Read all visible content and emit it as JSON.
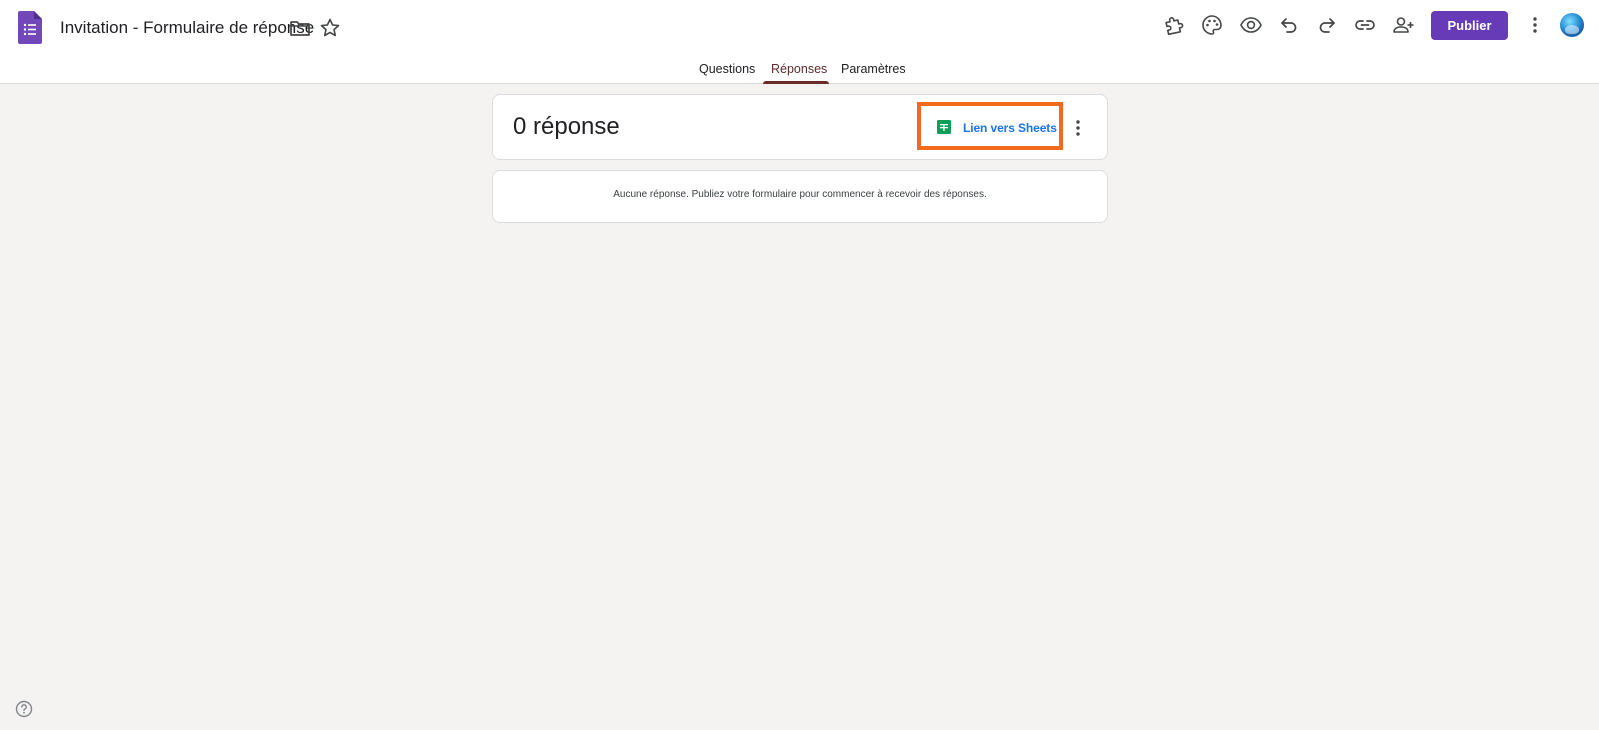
{
  "header": {
    "title": "Invitation - Formulaire de réponse",
    "publish_label": "Publier",
    "icons": [
      "forms-logo-icon",
      "folder-icon",
      "star-icon",
      "addon-puzzle-icon",
      "palette-icon",
      "preview-eye-icon",
      "undo-icon",
      "redo-icon",
      "link-icon",
      "add-collaborator-icon",
      "more-vert-icon",
      "avatar"
    ]
  },
  "tabs": [
    {
      "label": "Questions",
      "active": false
    },
    {
      "label": "Réponses",
      "active": true
    },
    {
      "label": "Paramètres",
      "active": false
    }
  ],
  "summary": {
    "count_label": "0 réponse",
    "sheets_link_label": "Lien vers Sheets"
  },
  "empty_state": {
    "message": "Aucune réponse. Publiez votre formulaire pour commencer à recevoir des réponses."
  },
  "colors": {
    "brand": "#673ab7",
    "highlight_border": "#f26a1b",
    "link": "#1a73e8",
    "sheets_green": "#0f9d58",
    "background": "#f4f3f1"
  }
}
